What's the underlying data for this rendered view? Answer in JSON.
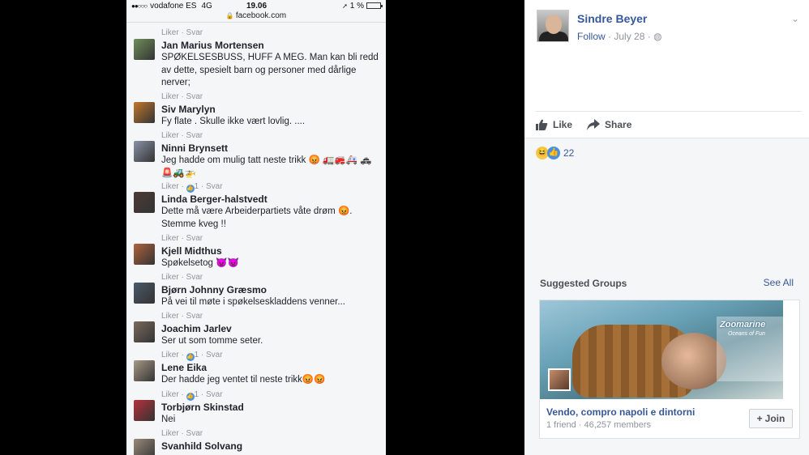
{
  "phone": {
    "status": {
      "signal": "●●○○○",
      "carrier": "vodafone ES",
      "network": "4G",
      "time": "19.06",
      "battery": "1 %"
    },
    "url": "facebook.com",
    "comments": [
      {
        "name": "Jan Marius Mortensen",
        "text": "SPØKELSESBUSS, HUFF A MEG. Man kan bli redd av dette, spesielt barn og personer med dårlige nerver;",
        "meta": "Liker · Svar",
        "avatar_color": "#6f8f5a"
      },
      {
        "name": "Siv Marylyn",
        "text": "Fy flate . Skulle ikke vært lovlig. ....",
        "meta": "Liker · Svar",
        "avatar_color": "#c1782c"
      },
      {
        "name": "Ninni Brynsett",
        "text": "Jeg hadde om mulig tatt neste trikk 😡 🚛🚒🚑 🚓🚨🚜🚁",
        "meta": "Liker · Svar",
        "avatar_color": "#8a93a8"
      },
      {
        "name": "Linda Berger-halstvedt",
        "text": "Dette må være Arbeiderpartiets våte drøm 😡. Stemme kveg !!",
        "meta_prefix": "Liker · ",
        "meta_count": "1",
        "meta_suffix": " · Svar",
        "avatar_color": "#4c3b35"
      },
      {
        "name": "Kjell Midthus",
        "text": "Spøkelsetog 👿👿",
        "meta": "Liker · Svar",
        "avatar_color": "#b0623d"
      },
      {
        "name": "Bjørn Johnny Græsmo",
        "text": "På vei til møte i spøkelseskladdens venner...",
        "meta": "Liker · Svar",
        "avatar_color": "#4a5a6a"
      },
      {
        "name": "Joachim Jarlev",
        "text": "Ser ut som tomme seter.",
        "meta": "Liker · Svar",
        "avatar_color": "#7a6a5e"
      },
      {
        "name": "Lene Eika",
        "text": "Der hadde jeg ventet til neste trikk😡😡",
        "meta_prefix": "Liker · ",
        "meta_count": "1",
        "meta_suffix": " · Svar",
        "avatar_color": "#a89a86"
      },
      {
        "name": "Torbjørn Skinstad",
        "text": "Nei",
        "meta_prefix": "Liker · ",
        "meta_count": "1",
        "meta_suffix": " · Svar",
        "avatar_color": "#b7313b"
      },
      {
        "name": "Svanhild Solvang",
        "text": "",
        "meta": "Liker · Svar",
        "avatar_color": "#9a8b7a"
      }
    ]
  },
  "post": {
    "author": "Sindre Beyer",
    "follow": "Follow",
    "date": "July 28",
    "sep1": " · ",
    "sep2": " · ",
    "privacy_icon": "globe-icon",
    "like_label": "Like",
    "share_label": "Share",
    "reaction_count": "22"
  },
  "suggested": {
    "heading": "Suggested Groups",
    "see_all": "See All",
    "group_logo": "Zoomarine",
    "group_logo_sub": "Oceans of Fun",
    "group_name": "Vendo, compro napoli e dintorni",
    "group_meta": "1 friend · 46,257 members",
    "join_label": "Join"
  }
}
